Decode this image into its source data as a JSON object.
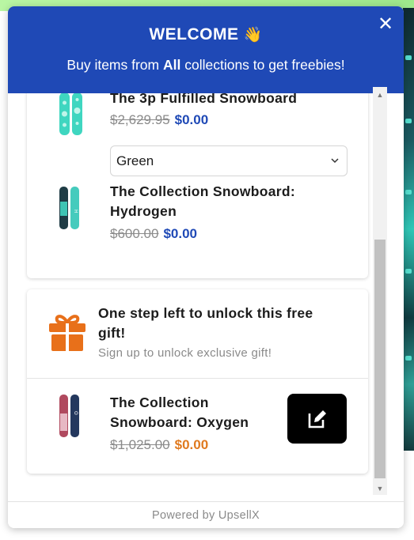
{
  "header": {
    "title": "WELCOME",
    "wave_emoji": "👋",
    "subtitle_before": "Buy items from ",
    "subtitle_bold": "All",
    "subtitle_after": " collections to get freebies!",
    "close_symbol": "✕"
  },
  "products": [
    {
      "title": "The 3p Fulfilled Snowboard",
      "old_price": "$2,629.95",
      "new_price": "$0.00",
      "variant": "Green"
    },
    {
      "title_line1": "The Collection Snowboard:",
      "title_line2": "Hydrogen",
      "old_price": "$600.00",
      "new_price": "$0.00"
    }
  ],
  "gift": {
    "title_line1": "One step left to unlock this free",
    "title_line2": "gift!",
    "subtitle": "Sign up to unlock exclusive gift!",
    "product": {
      "title_line1": "The Collection",
      "title_line2": "Snowboard: Oxygen",
      "old_price": "$1,025.00",
      "new_price": "$0.00"
    }
  },
  "footer": {
    "text": "Powered by UpsellX"
  },
  "colors": {
    "brand_blue": "#1f49b6",
    "orange": "#e07a1f",
    "gift_icon": "#e8701a"
  }
}
